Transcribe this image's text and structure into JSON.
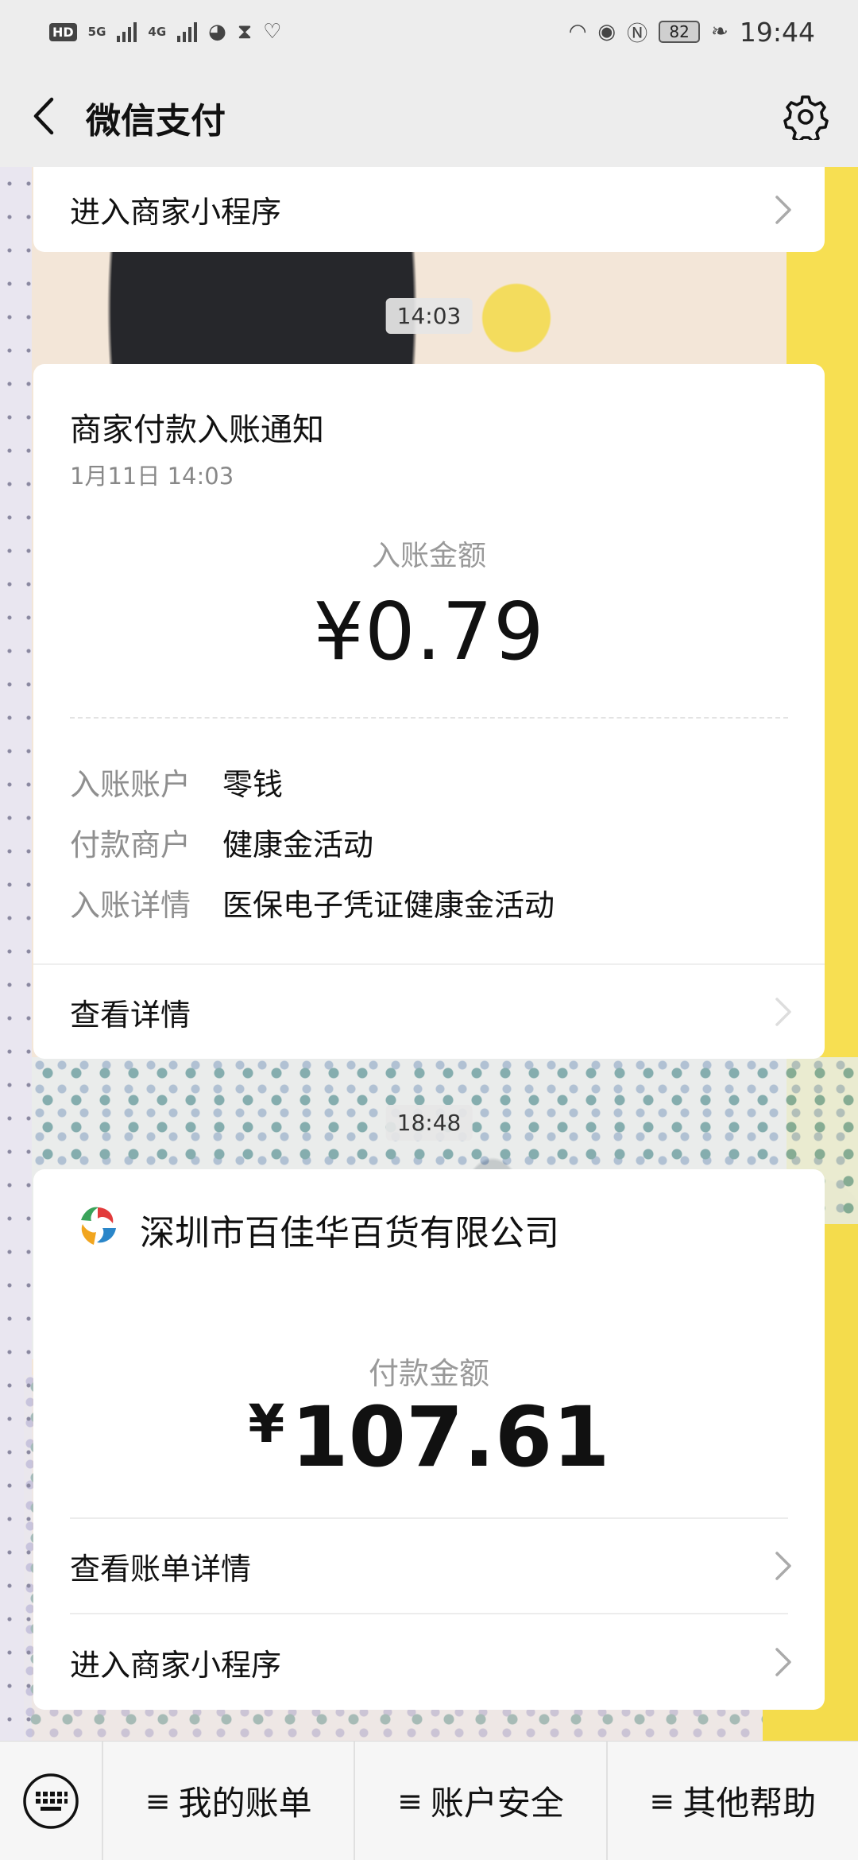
{
  "status_bar": {
    "hd": "HD",
    "net1": "5G",
    "net2": "4G",
    "battery": "82",
    "time": "19:44"
  },
  "nav": {
    "title": "微信支付"
  },
  "card_top": {
    "link_label": "进入商家小程序"
  },
  "messages": [
    {
      "timestamp": "14:03",
      "title": "商家付款入账通知",
      "date": "1月11日  14:03",
      "amount_label": "入账金额",
      "amount": "¥0.79",
      "details": [
        {
          "key": "入账账户",
          "value": "零钱"
        },
        {
          "key": "付款商户",
          "value": "健康金活动"
        },
        {
          "key": "入账详情",
          "value": "医保电子凭证健康金活动"
        }
      ],
      "link_label": "查看详情"
    },
    {
      "timestamp": "18:48",
      "merchant": "深圳市百佳华百货有限公司",
      "amount_label": "付款金额",
      "amount_symbol": "¥",
      "amount_value": "107.61",
      "links": [
        {
          "label": "查看账单详情"
        },
        {
          "label": "进入商家小程序"
        }
      ]
    }
  ],
  "bottom_menu": {
    "items": [
      {
        "label": "我的账单"
      },
      {
        "label": "账户安全"
      },
      {
        "label": "其他帮助"
      }
    ]
  },
  "icons": {
    "back": "back-arrow-icon",
    "settings": "gear-icon",
    "keyboard": "keyboard-icon",
    "menu": "menu-lines-icon",
    "chevron": "chevron-right-icon"
  },
  "colors": {
    "bar_bg": "#ededed",
    "card_bg": "#ffffff",
    "secondary_text": "#8f8f8f"
  }
}
